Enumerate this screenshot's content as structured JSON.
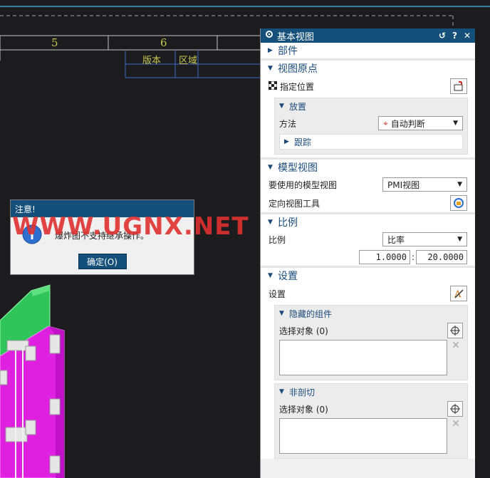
{
  "drawing": {
    "col_numbers": [
      "5",
      "6"
    ],
    "title_block": [
      "版本",
      "区域"
    ]
  },
  "panel": {
    "title": "基本视图",
    "header_buttons": [
      "↺",
      "?",
      "✕"
    ],
    "sections": {
      "parts": {
        "label": "部件"
      },
      "view_origin": {
        "label": "视图原点",
        "specify_location": "指定位置",
        "placement": {
          "label": "放置",
          "method_label": "方法",
          "method_value": "自动判断",
          "track_label": "跟踪"
        }
      },
      "model_view": {
        "label": "模型视图",
        "use_label": "要使用的模型视图",
        "use_value": "PMI视图",
        "orient_label": "定向视图工具"
      },
      "scale": {
        "label": "比例",
        "scale_label": "比例",
        "scale_value": "比率",
        "ratio_left": "1.0000",
        "ratio_sep": ":",
        "ratio_right": "20.0000"
      },
      "settings": {
        "label": "设置",
        "settings_label": "设置",
        "hidden": {
          "label": "隐藏的组件",
          "select": "选择对象 (0)"
        },
        "non_section": {
          "label": "非剖切",
          "select": "选择对象 (0)"
        }
      }
    }
  },
  "dialog": {
    "title": "注意!",
    "message": "爆炸图不支持继承操作。",
    "ok_label": "确定(O)"
  },
  "watermark": "WWW.UGNX.NET",
  "colors": {
    "accent": "#14507a",
    "cad_line": "#c8c8c8",
    "green": "#2fc55a",
    "magenta": "#e020e0"
  }
}
